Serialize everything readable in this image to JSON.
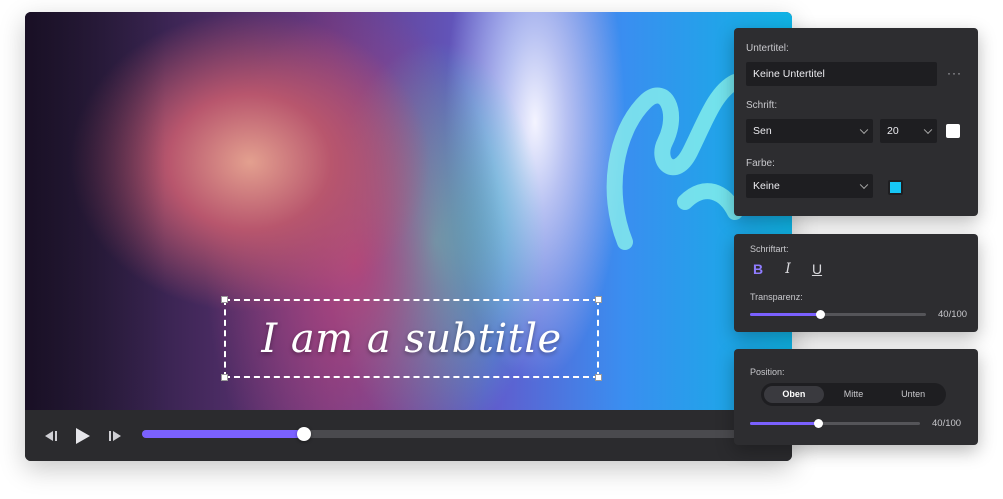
{
  "video": {
    "subtitle": "I am a subtitle",
    "progress_fraction": 0.27
  },
  "subtitle_panel": {
    "subtitle_label": "Untertitel:",
    "subtitle_value": "Keine Untertitel",
    "more_icon": "···",
    "font_label": "Schrift:",
    "font_value": "Sen",
    "size_value": "20",
    "font_color_swatch": "#ffffff",
    "color_label": "Farbe:",
    "color_value": "Keine",
    "color_swatch": "#16c6f5"
  },
  "style_panel": {
    "style_label": "Schriftart:",
    "bold": "B",
    "italic": "I",
    "underline": "U",
    "transparency_label": "Transparenz:",
    "transparency_fraction": 0.4,
    "transparency_text": "40/100"
  },
  "position_panel": {
    "position_label": "Position:",
    "options": [
      "Oben",
      "Mitte",
      "Unten"
    ],
    "selected": "Oben",
    "slider_fraction": 0.4,
    "slider_text": "40/100"
  },
  "colors": {
    "accent": "#7b61ff",
    "panel": "#2d2d30"
  }
}
